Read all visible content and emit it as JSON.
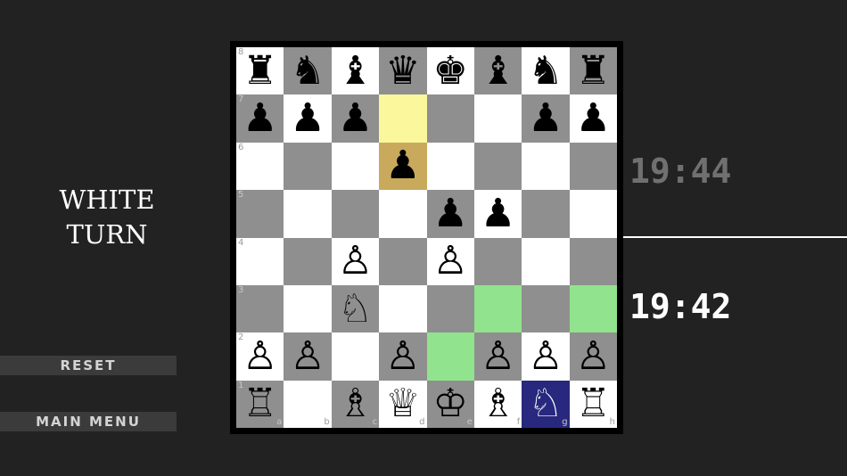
{
  "turn": {
    "line1": "WHITE",
    "line2": "TURN"
  },
  "menu": {
    "reset_label": "RESET",
    "main_menu_label": "MAIN MENU"
  },
  "clocks": {
    "top": "19:44",
    "bottom": "19:42"
  },
  "colors": {
    "light_square": "#ffffff",
    "dark_square": "#8f8f8f",
    "last_move_from": "#faf79c",
    "last_move_to": "#c9a95c",
    "legal_move": "#91e48d",
    "selected": "#28287e",
    "background": "#212221"
  },
  "board": {
    "files": [
      "a",
      "b",
      "c",
      "d",
      "e",
      "f",
      "g",
      "h"
    ],
    "ranks": [
      "8",
      "7",
      "6",
      "5",
      "4",
      "3",
      "2",
      "1"
    ],
    "pieces": [
      [
        "♜",
        "♞",
        "♝",
        "♛",
        "♚",
        "♝",
        "♞",
        "♜"
      ],
      [
        "♟",
        "♟",
        "♟",
        "",
        "",
        "",
        "♟",
        "♟"
      ],
      [
        "",
        "",
        "",
        "♟",
        "",
        "",
        "",
        ""
      ],
      [
        "",
        "",
        "",
        "",
        "♟",
        "♟",
        "",
        ""
      ],
      [
        "",
        "",
        "♙",
        "",
        "♙",
        "",
        "",
        ""
      ],
      [
        "",
        "",
        "♘",
        "",
        "",
        "",
        "",
        ""
      ],
      [
        "♙",
        "♙",
        "",
        "♙",
        "",
        "♙",
        "♙",
        "♙"
      ],
      [
        "♖",
        "",
        "♗",
        "♕",
        "♔",
        "♗",
        "♘",
        "♖"
      ]
    ],
    "piece_colors": [
      [
        "b",
        "b",
        "b",
        "b",
        "b",
        "b",
        "b",
        "b"
      ],
      [
        "b",
        "b",
        "b",
        "",
        "",
        "",
        "b",
        "b"
      ],
      [
        "",
        "",
        "",
        "b",
        "",
        "",
        "",
        ""
      ],
      [
        "",
        "",
        "",
        "",
        "b",
        "b",
        "",
        ""
      ],
      [
        "",
        "",
        "w",
        "",
        "w",
        "",
        "",
        ""
      ],
      [
        "",
        "",
        "w",
        "",
        "",
        "",
        "",
        ""
      ],
      [
        "w",
        "w",
        "",
        "w",
        "",
        "w",
        "w",
        "w"
      ],
      [
        "w",
        "",
        "w",
        "w",
        "w",
        "w",
        "w",
        "w"
      ]
    ],
    "highlights": {
      "last_move_from": [
        "d7"
      ],
      "last_move_to": [
        "d6"
      ],
      "legal_moves": [
        "f3",
        "h3",
        "e2"
      ],
      "selected": [
        "g1"
      ]
    }
  }
}
